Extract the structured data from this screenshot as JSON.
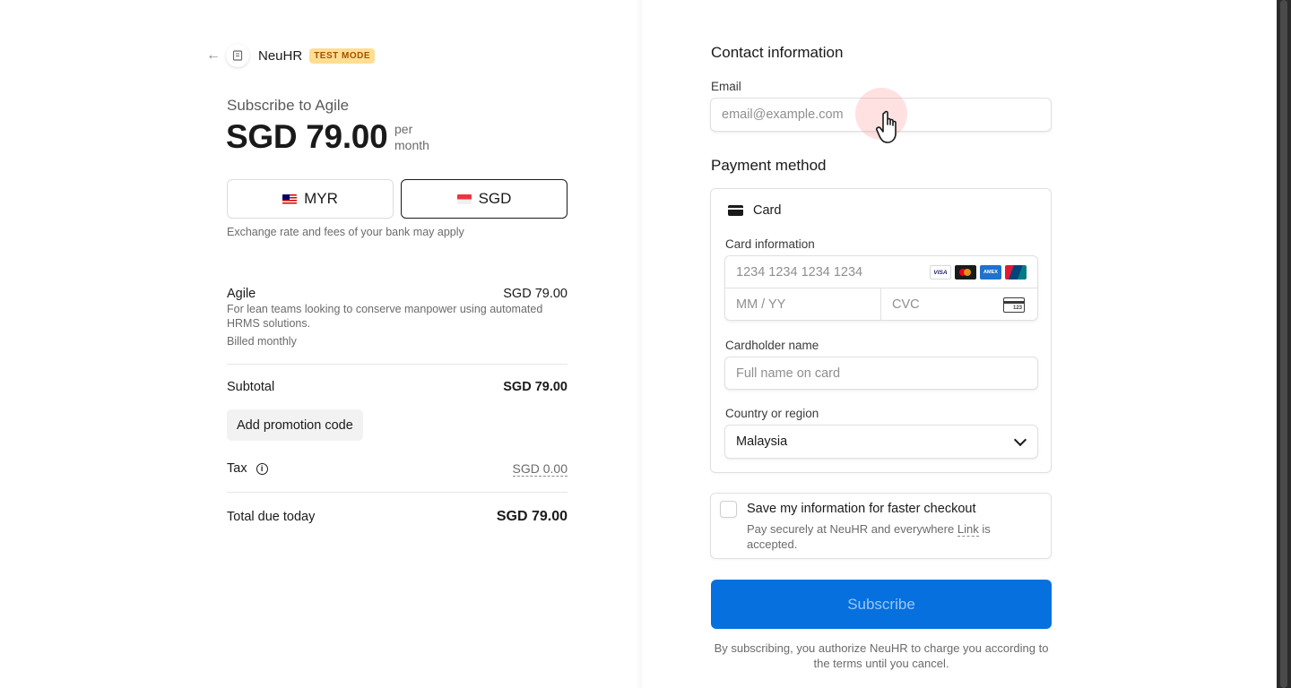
{
  "header": {
    "brand": "NeuHR",
    "badge": "TEST MODE"
  },
  "summary": {
    "subscribe_title": "Subscribe to Agile",
    "price": "SGD 79.00",
    "period": "per month",
    "currencies": [
      {
        "code": "MYR",
        "selected": false
      },
      {
        "code": "SGD",
        "selected": true
      }
    ],
    "fx_note": "Exchange rate and fees of your bank may apply",
    "item": {
      "name": "Agile",
      "price": "SGD 79.00",
      "description": "For lean teams looking to conserve manpower using automated HRMS solutions.",
      "billing": "Billed monthly"
    },
    "subtotal_label": "Subtotal",
    "subtotal_value": "SGD 79.00",
    "promo_label": "Add promotion code",
    "tax_label": "Tax",
    "tax_value": "SGD 0.00",
    "total_label": "Total due today",
    "total_value": "SGD 79.00"
  },
  "form": {
    "contact_title": "Contact information",
    "email_label": "Email",
    "email_placeholder": "email@example.com",
    "payment_title": "Payment method",
    "card_tab": "Card",
    "card_info_label": "Card information",
    "card_number_placeholder": "1234 1234 1234 1234",
    "expiry_placeholder": "MM / YY",
    "cvc_placeholder": "CVC",
    "card_brands": [
      "VISA",
      "mastercard",
      "AMEX",
      "UnionPay"
    ],
    "cardholder_label": "Cardholder name",
    "cardholder_placeholder": "Full name on card",
    "country_label": "Country or region",
    "country_value": "Malaysia",
    "save_title": "Save my information for faster checkout",
    "save_sub_before": "Pay securely at NeuHR and everywhere ",
    "save_sub_link": "Link",
    "save_sub_after": " is accepted.",
    "subscribe_label": "Subscribe",
    "terms": "By subscribing, you authorize NeuHR to charge you according to the terms until you cancel."
  },
  "colors": {
    "accent": "#0570de",
    "badge_bg": "#ffde92",
    "badge_text": "#a35200"
  }
}
